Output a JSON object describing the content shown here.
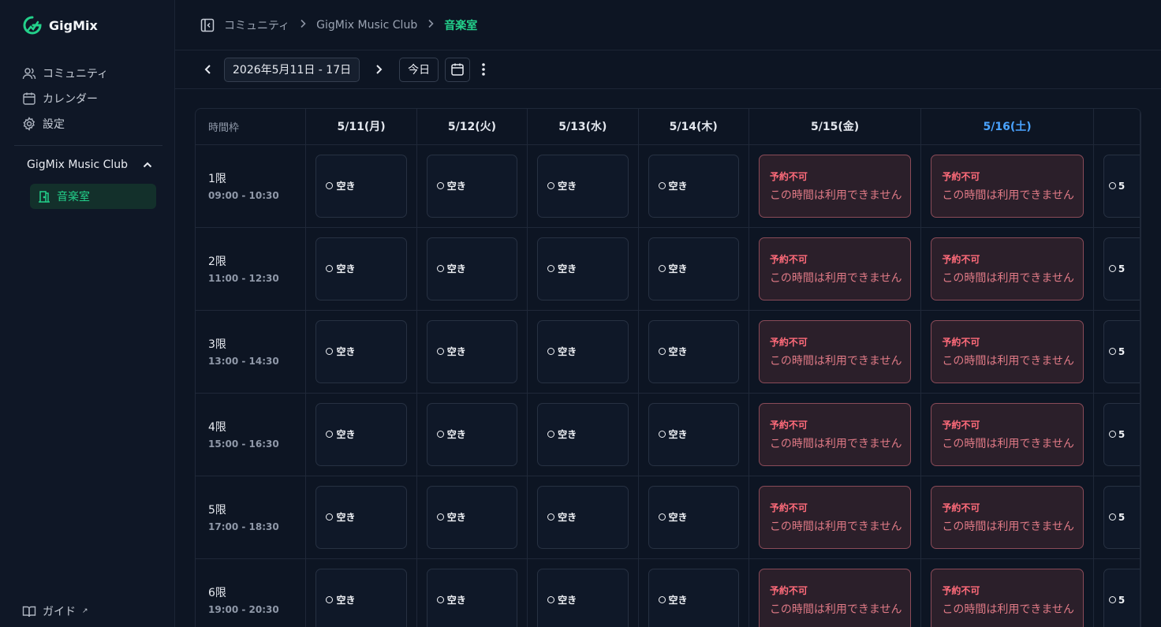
{
  "app": {
    "name": "GigMix",
    "brand_color": "#23d18b"
  },
  "sidebar": {
    "items": [
      {
        "label": "コミュニティ",
        "icon": "users-icon"
      },
      {
        "label": "カレンダー",
        "icon": "calendar-icon"
      },
      {
        "label": "設定",
        "icon": "gear-icon"
      }
    ],
    "group": {
      "label": "GigMix Music Club",
      "icon": "chevron-up-icon"
    },
    "room": {
      "label": "音楽室",
      "icon": "door-icon"
    },
    "guide": {
      "label": "ガイド",
      "icon": "book-icon",
      "external_mark": "↗"
    }
  },
  "breadcrumb": {
    "items": [
      "コミュニティ",
      "GigMix Music Club"
    ],
    "current": "音楽室"
  },
  "toolbar": {
    "date_range": "2026年5月11日 - 17日",
    "today_label": "今日"
  },
  "schedule": {
    "time_header": "時間枠",
    "days": [
      {
        "label": "5/11(月)",
        "saturday": false
      },
      {
        "label": "5/12(火)",
        "saturday": false
      },
      {
        "label": "5/13(水)",
        "saturday": false
      },
      {
        "label": "5/14(木)",
        "saturday": false
      },
      {
        "label": "5/15(金)",
        "saturday": false
      },
      {
        "label": "5/16(土)",
        "saturday": true
      },
      {
        "label": "",
        "saturday": false
      }
    ],
    "periods": [
      {
        "name": "1限",
        "range": "09:00 - 10:30"
      },
      {
        "name": "2限",
        "range": "11:00 - 12:30"
      },
      {
        "name": "3限",
        "range": "13:00 - 14:30"
      },
      {
        "name": "4限",
        "range": "15:00 - 16:30"
      },
      {
        "name": "5限",
        "range": "17:00 - 18:30"
      },
      {
        "name": "6限",
        "range": "19:00 - 20:30"
      }
    ],
    "cell_states": [
      "available",
      "available",
      "available",
      "available",
      "blocked",
      "blocked",
      "available-partial"
    ],
    "available_label": "空き",
    "partial_label": "5",
    "blocked_title": "予約不可",
    "blocked_message": "この時間は利用できません"
  }
}
